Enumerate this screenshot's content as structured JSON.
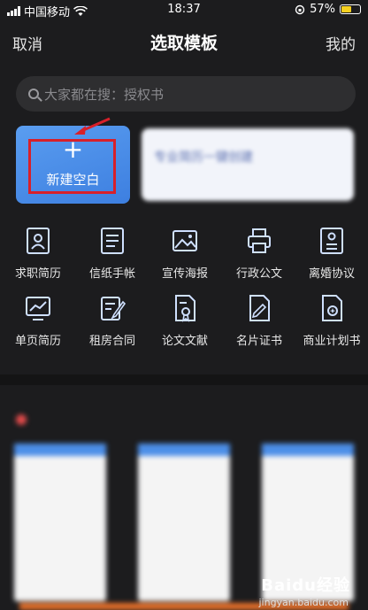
{
  "status_bar": {
    "carrier": "中国移动",
    "time": "18:37",
    "battery_percent": "57%",
    "battery_level": 0.57
  },
  "nav": {
    "cancel_label": "取消",
    "title": "选取模板",
    "mine_label": "我的"
  },
  "search": {
    "placeholder": "大家都在搜：授权书"
  },
  "new_blank": {
    "label": "新建空白"
  },
  "promo": {
    "title": "专业简历一键创建"
  },
  "categories": [
    {
      "label": "求职简历",
      "icon": "resume-icon"
    },
    {
      "label": "信纸手帐",
      "icon": "letter-paper-icon"
    },
    {
      "label": "宣传海报",
      "icon": "poster-icon"
    },
    {
      "label": "行政公文",
      "icon": "printer-icon"
    },
    {
      "label": "离婚协议",
      "icon": "agreement-icon"
    },
    {
      "label": "单页简历",
      "icon": "chart-screen-icon"
    },
    {
      "label": "租房合同",
      "icon": "contract-icon"
    },
    {
      "label": "论文文献",
      "icon": "paper-icon"
    },
    {
      "label": "名片证书",
      "icon": "certificate-icon"
    },
    {
      "label": "商业计划书",
      "icon": "business-plan-icon"
    }
  ],
  "watermark": {
    "brand": "Baidu经验",
    "url": "jingyan.baidu.com"
  }
}
